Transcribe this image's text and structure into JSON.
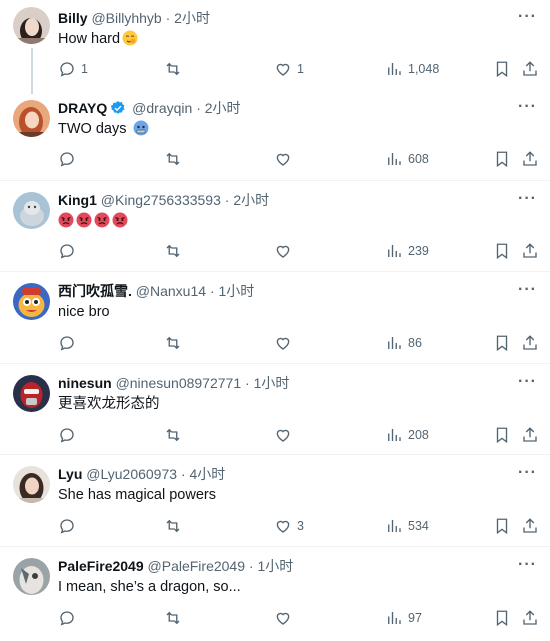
{
  "tweets": [
    {
      "name": "Billy",
      "handle": "@Billyhhyb",
      "time": "2小时",
      "text": "How hard",
      "emoji": "smirk-emoji",
      "replies": "1",
      "retweets": "",
      "likes": "1",
      "views": "1,048",
      "verified": false
    },
    {
      "name": "DRAYQ",
      "handle": "@drayqin",
      "time": "2小时",
      "text": "TWO days",
      "emoji": "cold-face-emoji",
      "replies": "",
      "retweets": "",
      "likes": "",
      "views": "608",
      "verified": true
    },
    {
      "name": "King1",
      "handle": "@King2756333593",
      "time": "2小时",
      "text": "",
      "emoji": "angry-face-emoji-x4",
      "replies": "",
      "retweets": "",
      "likes": "",
      "views": "239",
      "verified": false
    },
    {
      "name": "西门吹孤雪.",
      "handle": "@Nanxu14",
      "time": "1小时",
      "text": "nice bro",
      "replies": "",
      "retweets": "",
      "likes": "",
      "views": "86",
      "verified": false
    },
    {
      "name": "ninesun",
      "handle": "@ninesun08972771",
      "time": "1小时",
      "text": "更喜欢龙形态的",
      "replies": "",
      "retweets": "",
      "likes": "",
      "views": "208",
      "verified": false
    },
    {
      "name": "Lyu",
      "handle": "@Lyu2060973",
      "time": "4小时",
      "text": "She has magical powers",
      "replies": "",
      "retweets": "",
      "likes": "3",
      "views": "534",
      "verified": false
    },
    {
      "name": "PaleFire2049",
      "handle": "@PaleFire2049",
      "time": "1小时",
      "text": "I mean, she’s a dragon, so...",
      "replies": "",
      "retweets": "",
      "likes": "",
      "views": "97",
      "verified": false
    }
  ],
  "separator": "·",
  "colors": {
    "text": "#0f1419",
    "muted": "#536471",
    "verified": "#1d9bf0",
    "border": "#eff3f4"
  }
}
